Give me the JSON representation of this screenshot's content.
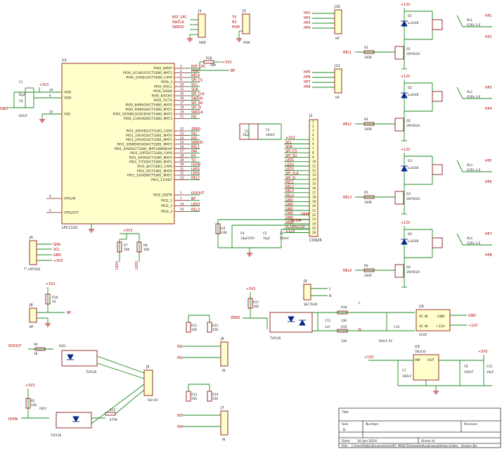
{
  "u1": {
    "ref": "U1",
    "part": "LPC111X",
    "left_pins": [
      {
        "num": "29",
        "name": "VDD"
      },
      {
        "num": "6",
        "name": "VDD"
      },
      {
        "num": "25",
        "name": "VSS"
      },
      {
        "num": "4",
        "name": "XTALIN"
      },
      {
        "num": "5",
        "name": "XTALOUT"
      }
    ],
    "right_pins": [
      {
        "num": "3",
        "name": "PIO0_0/RST",
        "net": "RST_LPC"
      },
      {
        "num": "2",
        "name": "PIO0_1/CLKOUT/CT32B0_MAT2",
        "net": "PGM"
      },
      {
        "num": "8",
        "name": "PIO0_2/SSEL0/CT16B0_CAP0",
        "net": "REL4"
      },
      {
        "num": "9",
        "name": "PIO0_3",
        "net": "SPI_CS"
      },
      {
        "num": "10",
        "name": "PIO0_4/SCL",
        "net": "SCL"
      },
      {
        "num": "11",
        "name": "PIO0_5/SDA",
        "net": "SDA"
      },
      {
        "num": "15",
        "name": "PIO0_6/SCK0",
        "net": "SPI_CLK"
      },
      {
        "num": "16",
        "name": "PIO0_7/CTS",
        "net": "SWDIO"
      },
      {
        "num": "17",
        "name": "PIO0_8/MISO0/CT16B0_MAT0",
        "net": "SPI_SO"
      },
      {
        "num": "18",
        "name": "PIO0_9/MOSI0/CT16B0_MAT1",
        "net": "SPI_SI"
      },
      {
        "num": "19",
        "name": "PIO0_10/SWCLK/SCK0/CT16B0_MAT2",
        "net": "SWCLK"
      },
      {
        "num": "21",
        "name": "PIO0_11/R/AD0/CT32B0_MAT3",
        "net": "IN1"
      },
      {
        "num": "22",
        "name": "PIO1_0/R/AD1/CT32B1_CAP0",
        "net": "ZERO"
      },
      {
        "num": "23",
        "name": "PIO1_1/R/AD2/CT32B1_MAT0",
        "net": "IN2"
      },
      {
        "num": "24",
        "name": "PIO1_2/R/AD3/CT32B1_MAT1",
        "net": "IN3"
      },
      {
        "num": "25",
        "name": "PIO1_3/SWDIO/AD4/CT32B1_MAT2",
        "net": "SWDIO"
      },
      {
        "num": "26",
        "name": "PIO1_4/AD5/CT32B1_MAT3/WAKEUP",
        "net": "REL1"
      },
      {
        "num": "27",
        "name": "PIO1_5/RTS/CT32B0_CAP0",
        "net": "IN4"
      },
      {
        "num": "28",
        "name": "PIO1_6/RXD/CT32B0_MAT0",
        "net": "RX"
      },
      {
        "num": "29",
        "name": "PIO1_7/TXD/CT32B0_MAT1",
        "net": "TX"
      },
      {
        "num": "30",
        "name": "PIO1_8/CT16B1_CAP0",
        "net": "ISOIN"
      },
      {
        "num": "31",
        "name": "PIO1_9/CT16B1_MAT0",
        "net": "LED1"
      },
      {
        "num": "12",
        "name": "PIO1_10/AD6/CT16B1_MAT1",
        "net": "LED2"
      },
      {
        "num": "13",
        "name": "PIO1_11/AD7",
        "net": "REL2"
      },
      {
        "num": "1",
        "name": "PIO2_0/DTR",
        "net": "ISOOUT"
      },
      {
        "num": "7",
        "name": "PIO2_1",
        "net": "BP"
      },
      {
        "num": "14",
        "name": "PIO2_2",
        "net": "LED3"
      },
      {
        "num": "20",
        "name": "PIO2_3",
        "net": "REL3"
      }
    ]
  },
  "top_connectors": {
    "j1": {
      "ref": "J1",
      "nets": [
        "RST_LPC",
        "SWCLK",
        "SWDIO"
      ],
      "name": "SWD"
    },
    "j3": {
      "ref": "J3",
      "nets": [
        "TX",
        "RX",
        "PGM"
      ],
      "name": "PGM"
    },
    "r_pgm": {
      "ref": "R18",
      "value": "10K",
      "supply": "+3V3",
      "net": "BP"
    }
  },
  "bus": {
    "ref": "J2",
    "part": "CON26",
    "rows": [
      "",
      "",
      "",
      "",
      "+3V3",
      "SCL",
      "SDA",
      "SPI_CS",
      "SPI_SO",
      "LED1",
      "LED2",
      "LED3",
      "SPI_CLK",
      "SPI_SI",
      "REL1",
      "REL2",
      "REL3",
      "REL4",
      "GND",
      "GND",
      "GND",
      "GND",
      "GND",
      "VREF",
      "VCOM",
      "+12V"
    ],
    "caps": [
      {
        "ref": "C2",
        "value": "10µF"
      },
      {
        "ref": "C3",
        "value": "100nF"
      },
      {
        "ref": "C9",
        "value": "10µF/25V"
      },
      {
        "ref": "C5",
        "value": "10µF"
      },
      {
        "ref": "C4",
        "value": "100nF"
      }
    ],
    "r10": {
      "ref": "R10",
      "value": "510K"
    },
    "labels": {
      "vref": "VREF",
      "vcom": "VCOM",
      "v12": "+12V"
    }
  },
  "relay_channels": [
    {
      "d": "D1",
      "q": "Q1",
      "rl": "RL1",
      "r": "R3",
      "rel": "REL1",
      "hp_a": "HP1",
      "hp_b": "HP2"
    },
    {
      "d": "D2",
      "q": "Q2",
      "rl": "RL2",
      "r": "R4",
      "rel": "REL2",
      "hp_a": "HP3",
      "hp_b": "HP4"
    },
    {
      "d": "D3",
      "q": "Q3",
      "rl": "RL3",
      "r": "R5",
      "rel": "REL3",
      "hp_a": "HP5",
      "hp_b": "HP6"
    },
    {
      "d": "D4",
      "q": "Q4",
      "rl": "RL4",
      "r": "R6",
      "rel": "REL4",
      "hp_a": "HP7",
      "hp_b": "HP8"
    }
  ],
  "relay_common": {
    "diode": "LL4148",
    "mosfet": "2N7002A",
    "relay": "G2RL-1-E",
    "resistor": "100R",
    "supply": "+12V"
  },
  "hp_connectors": [
    {
      "ref": "J10",
      "name": "HP",
      "nets": [
        "HP1",
        "HP2",
        "HP3",
        "HP4"
      ]
    },
    {
      "ref": "J11",
      "name": "HP",
      "nets": [
        "HP5",
        "HP6",
        "HP7",
        "HP8"
      ]
    }
  ],
  "power_c1": {
    "c1": "C1",
    "c1v": "10µF",
    "c6": "C6",
    "c6v": "100nF",
    "supply": "+3V3",
    "gnd": "GND"
  },
  "sensor": {
    "ref": "J4",
    "name": "T° LM75AD",
    "nets": [
      "SDA",
      "SCL",
      "GND",
      "+3V3"
    ]
  },
  "leds": {
    "r7": {
      "ref": "R7",
      "value": "1K8"
    },
    "r8": {
      "ref": "R8",
      "value": "1K8"
    },
    "l1": "LED1",
    "l2": "LED2",
    "supply": "+3V3"
  },
  "bp": {
    "ref": "J8",
    "name": "BP",
    "r": "R16",
    "rv": "1K",
    "net": "BP",
    "supply": "+3V3"
  },
  "zero": {
    "ref": "R17",
    "value": "10K",
    "net": "ZERO",
    "opto": "TLP126",
    "supply": "+3V3"
  },
  "sector": {
    "ref": "J9",
    "name": "SECTEUR",
    "L": "L",
    "N": "N",
    "r18": "R18",
    "r19": "R19",
    "r18v": "33K",
    "r19v": "33K",
    "c11": "C11",
    "c11v": "1nF",
    "c10": "C10",
    "c10v": "100nF X2"
  },
  "acdc": {
    "ref": "U5",
    "name": "ACDC",
    "p1": "AC IN",
    "p2": "GND",
    "p3": "AC IN",
    "p4": "+12V",
    "out": "+12V",
    "gnd": "GND"
  },
  "ldo": {
    "ref": "U3",
    "part": "78L033",
    "in": "INP",
    "out": "OUT",
    "c7": "C7",
    "c7v": "100nF",
    "c8": "C8",
    "c8v": "100nF",
    "c12": "C12",
    "c12v": "10µF",
    "vin": "+12V",
    "vout": "+3V3"
  },
  "iso": {
    "isoout": "ISOOUT",
    "isoin": "ISOIN",
    "r9": "R9",
    "r9v": "1K",
    "r2": "R2",
    "r2v": "15K",
    "r15": "R15",
    "r15v": "475R",
    "iso1": "ISO1",
    "iso2": "ISO2",
    "opto": "TLP126",
    "j5": "J5",
    "j5name": "ISO I/O",
    "supply": "+3V3"
  },
  "inputs": [
    {
      "ref": "J6",
      "name": "IN",
      "r_a": "R11",
      "r_b": "R12",
      "value": "15K",
      "nets": [
        "IN1",
        "IN2"
      ]
    },
    {
      "ref": "J7",
      "name": "IN",
      "r_a": "R13",
      "r_b": "R14",
      "value": "15K",
      "nets": [
        "IN3",
        "IN4"
      ]
    }
  ],
  "title_block": {
    "title": "Title",
    "size": "Size",
    "size_value": "B",
    "number": "Number",
    "revision": "Revision",
    "date": "Date:",
    "date_value": "16-Jan-2016",
    "sheet": "Sheet of",
    "file": "File:",
    "file_value": "C:\\Users\\Public\\Documents\\CLIENT_PROJETS\\Embedded\\audio\\ampli\\Relais.SchDoc",
    "drawn": "Drawn By:"
  }
}
